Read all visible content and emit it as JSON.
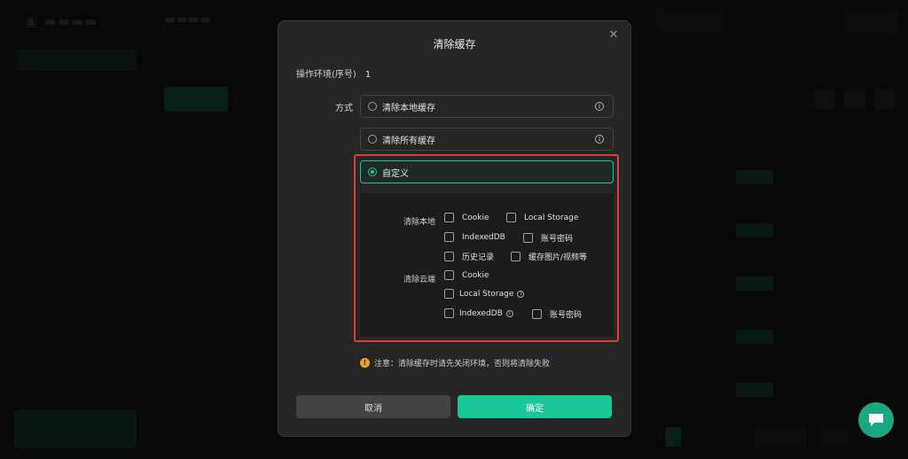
{
  "modal": {
    "title": "清除缓存",
    "close_icon": "close-icon",
    "env_label": "操作环境(序号)",
    "env_value": "1",
    "method_label": "方式",
    "options": {
      "local": "清除本地缓存",
      "all": "清除所有缓存",
      "custom": "自定义"
    },
    "selected_option": "custom",
    "local_section": {
      "label": "清除本地",
      "items": {
        "cookie": "Cookie",
        "local_storage": "Local Storage",
        "indexeddb": "IndexedDB",
        "account_password": "账号密码",
        "history": "历史记录",
        "cached_media": "缓存图片/视频等"
      }
    },
    "cloud_section": {
      "label": "清除云端",
      "items": {
        "cookie": "Cookie",
        "local_storage": "Local Storage",
        "indexeddb": "IndexedDB",
        "account_password": "账号密码"
      }
    },
    "warning": "注意：清除缓存时请先关闭环境，否则将清除失败",
    "cancel_label": "取消",
    "confirm_label": "确定"
  },
  "colors": {
    "accent": "#19c79a",
    "highlight_frame": "#d9403a",
    "warning": "#f0a020",
    "modal_bg": "#262626"
  }
}
